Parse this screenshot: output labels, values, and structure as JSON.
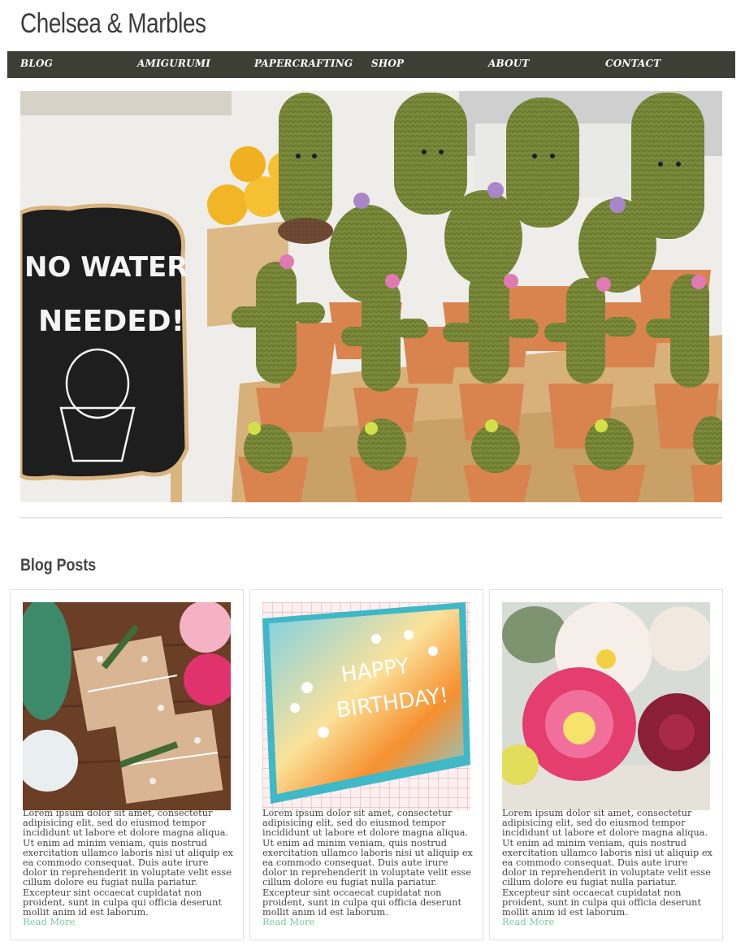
{
  "site": {
    "title": "Chelsea & Marbles"
  },
  "nav": {
    "items": [
      {
        "label": "BLOG"
      },
      {
        "label": "AMIGURUMI"
      },
      {
        "label": "PAPERCRAFTING"
      },
      {
        "label": "SHOP"
      },
      {
        "label": "ABOUT"
      },
      {
        "label": "CONTACT"
      }
    ]
  },
  "hero": {
    "sign_line1": "NO WATER",
    "sign_line2": "NEEDED!"
  },
  "blog": {
    "heading": "Blog Posts",
    "posts": [
      {
        "excerpt": "Lorem ipsum dolor sit amet, consectetur adipisicing elit, sed do eiusmod tempor incididunt ut labore et dolore magna aliqua. Ut enim ad minim veniam, quis nostrud exercitation ullamco laboris nisi ut aliquip ex ea commodo consequat. Duis aute irure dolor in reprehenderit in voluptate velit esse cillum dolore eu fugiat nulla pariatur. Excepteur sint occaecat cupidatat non proident, sunt in culpa qui officia deserunt mollit anim id est laborum.",
        "read_more": "Read More"
      },
      {
        "excerpt": "Lorem ipsum dolor sit amet, consectetur adipisicing elit, sed do eiusmod tempor incididunt ut labore et dolore magna aliqua. Ut enim ad minim veniam, quis nostrud exercitation ullamco laboris nisi ut aliquip ex ea commodo consequat. Duis aute irure dolor in reprehenderit in voluptate velit esse cillum dolore eu fugiat nulla pariatur. Excepteur sint occaecat cupidatat non proident, sunt in culpa qui officia deserunt mollit anim id est laborum.",
        "read_more": "Read More",
        "card_text_line1": "HAPPY",
        "card_text_line2": "BIRTHDAY!"
      },
      {
        "excerpt": "Lorem ipsum dolor sit amet, consectetur adipisicing elit, sed do eiusmod tempor incididunt ut labore et dolore magna aliqua. Ut enim ad minim veniam, quis nostrud exercitation ullamco laboris nisi ut aliquip ex ea commodo consequat. Duis aute irure dolor in reprehenderit in voluptate velit esse cillum dolore eu fugiat nulla pariatur. Excepteur sint occaecat cupidatat non proident, sunt in culpa qui officia deserunt mollit anim id est laborum.",
        "read_more": "Read More"
      }
    ]
  },
  "colors": {
    "nav_bg": "#3d3e36",
    "link_accent": "#7cc9a0",
    "divider": "#e3e3e3"
  }
}
